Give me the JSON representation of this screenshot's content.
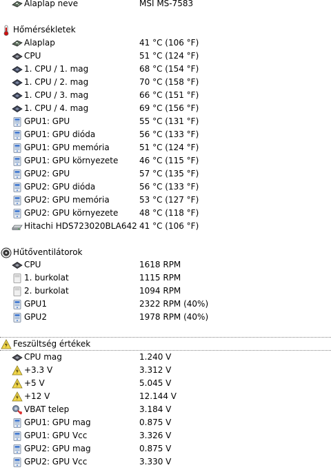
{
  "motherboard": {
    "label": "Alaplap neve",
    "value": "MSI MS-7583"
  },
  "temperatures": {
    "title": "Hőmérsékletek",
    "items": [
      {
        "label": "Alaplap",
        "value": "41 °C  (106 °F)",
        "icon": "motherboard-icon"
      },
      {
        "label": "CPU",
        "value": "51 °C  (124 °F)",
        "icon": "cpu-icon"
      },
      {
        "label": "1. CPU / 1. mag",
        "value": "68 °C  (154 °F)",
        "icon": "cpu-core-icon"
      },
      {
        "label": "1. CPU / 2. mag",
        "value": "70 °C  (158 °F)",
        "icon": "cpu-core-icon"
      },
      {
        "label": "1. CPU / 3. mag",
        "value": "66 °C  (151 °F)",
        "icon": "cpu-core-icon"
      },
      {
        "label": "1. CPU / 4. mag",
        "value": "69 °C  (156 °F)",
        "icon": "cpu-core-icon"
      },
      {
        "label": "GPU1: GPU",
        "value": "55 °C  (131 °F)",
        "icon": "gpu-icon"
      },
      {
        "label": "GPU1: GPU dióda",
        "value": "56 °C  (133 °F)",
        "icon": "gpu-icon"
      },
      {
        "label": "GPU1: GPU memória",
        "value": "51 °C  (124 °F)",
        "icon": "gpu-icon"
      },
      {
        "label": "GPU1: GPU környezete",
        "value": "46 °C  (115 °F)",
        "icon": "gpu-icon"
      },
      {
        "label": "GPU2: GPU",
        "value": "57 °C  (135 °F)",
        "icon": "gpu-icon"
      },
      {
        "label": "GPU2: GPU dióda",
        "value": "56 °C  (133 °F)",
        "icon": "gpu-icon"
      },
      {
        "label": "GPU2: GPU memória",
        "value": "53 °C  (127 °F)",
        "icon": "gpu-icon"
      },
      {
        "label": "GPU2: GPU környezete",
        "value": "48 °C  (118 °F)",
        "icon": "gpu-icon"
      },
      {
        "label": "Hitachi HDS723020BLA642",
        "value": "41 °C  (106 °F)",
        "icon": "hard-drive-icon"
      }
    ]
  },
  "fans": {
    "title": "Hűtőventilátorok",
    "items": [
      {
        "label": "CPU",
        "value": "1618 RPM",
        "icon": "cpu-icon"
      },
      {
        "label": "1. burkolat",
        "value": "1115 RPM",
        "icon": "case-icon"
      },
      {
        "label": "2. burkolat",
        "value": "1094 RPM",
        "icon": "case-icon"
      },
      {
        "label": "GPU1",
        "value": "2322 RPM  (40%)",
        "icon": "gpu-icon"
      },
      {
        "label": "GPU2",
        "value": "1978 RPM  (40%)",
        "icon": "gpu-icon"
      }
    ]
  },
  "voltages": {
    "title": "Feszültség értékek",
    "items": [
      {
        "label": "CPU mag",
        "value": "1.240 V",
        "icon": "cpu-icon"
      },
      {
        "label": "+3.3 V",
        "value": "3.312 V",
        "icon": "voltage-warning-icon"
      },
      {
        "label": "+5 V",
        "value": "5.045 V",
        "icon": "voltage-warning-icon"
      },
      {
        "label": "+12 V",
        "value": "12.144 V",
        "icon": "voltage-warning-icon"
      },
      {
        "label": "VBAT telep",
        "value": "3.184 V",
        "icon": "battery-icon"
      },
      {
        "label": "GPU1: GPU mag",
        "value": "0.875 V",
        "icon": "gpu-icon"
      },
      {
        "label": "GPU1: GPU Vcc",
        "value": "3.326 V",
        "icon": "gpu-icon"
      },
      {
        "label": "GPU2: GPU mag",
        "value": "0.875 V",
        "icon": "gpu-icon"
      },
      {
        "label": "GPU2: GPU Vcc",
        "value": "3.330 V",
        "icon": "gpu-icon"
      }
    ]
  }
}
